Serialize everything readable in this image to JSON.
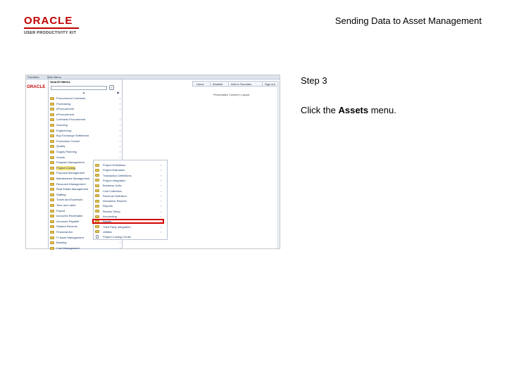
{
  "header": {
    "brand": "ORACLE",
    "product": "USER PRODUCTIVITY KIT",
    "doc_title": "Sending Data to Asset Management"
  },
  "screenshot": {
    "topbar": {
      "favorites": "Favorites",
      "main_menu": "Main Menu"
    },
    "mini_logo": "ORACLE",
    "nav": {
      "home": "Home",
      "worklist": "Worklist",
      "add_to_favorites": "Add to Favorites",
      "sign_out": "Sign out"
    },
    "personalize": "Personalize Content | Layout",
    "menu": {
      "title": "Search Menu:",
      "go": "»",
      "items": [
        {
          "label": "Procurement Contracts",
          "arrow": "›"
        },
        {
          "label": "Purchasing",
          "arrow": "›"
        },
        {
          "label": "eProcurement",
          "arrow": "›"
        },
        {
          "label": "eProcurement",
          "arrow": ""
        },
        {
          "label": "Contracts Procurement",
          "arrow": "›"
        },
        {
          "label": "Sourcing",
          "arrow": "›"
        },
        {
          "label": "Engineering",
          "arrow": "›"
        },
        {
          "label": "Buy Exchange Settlement",
          "arrow": "›"
        },
        {
          "label": "Production Control",
          "arrow": "›"
        },
        {
          "label": "Quality",
          "arrow": "›"
        },
        {
          "label": "Supply Planning",
          "arrow": "›"
        },
        {
          "label": "Grants",
          "arrow": "›"
        },
        {
          "label": "Program Management",
          "arrow": "›"
        },
        {
          "label": "Project Costing",
          "arrow": "›"
        },
        {
          "label": "Proposal Management",
          "arrow": "›"
        },
        {
          "label": "Maintenance Management",
          "arrow": "›"
        },
        {
          "label": "Resource Management",
          "arrow": "›"
        },
        {
          "label": "Real Estate Management",
          "arrow": "›"
        },
        {
          "label": "Staffing",
          "arrow": "›"
        },
        {
          "label": "Travel and Expenses",
          "arrow": "›"
        },
        {
          "label": "Time and Labor",
          "arrow": "›"
        },
        {
          "label": "Payroll",
          "arrow": "›"
        },
        {
          "label": "Accounts Receivable",
          "arrow": "›"
        },
        {
          "label": "Accounts Payable",
          "arrow": "›"
        },
        {
          "label": "Student Records",
          "arrow": "›"
        },
        {
          "label": "Financial Aid",
          "arrow": "›"
        },
        {
          "label": "IT Asset Management",
          "arrow": "›"
        },
        {
          "label": "Banking",
          "arrow": "›"
        },
        {
          "label": "Cost Management",
          "arrow": "›"
        }
      ]
    },
    "submenu": {
      "items": [
        {
          "label": "Project Definitions",
          "arrow": "›",
          "icon": "folder"
        },
        {
          "label": "Project Estimates",
          "arrow": "›",
          "icon": "folder"
        },
        {
          "label": "Transaction Definitions",
          "arrow": "›",
          "icon": "folder"
        },
        {
          "label": "Project Integration",
          "arrow": "›",
          "icon": "folder"
        },
        {
          "label": "Business Units",
          "arrow": "›",
          "icon": "folder"
        },
        {
          "label": "Cost Collection",
          "arrow": "›",
          "icon": "folder"
        },
        {
          "label": "Revenue Definition",
          "arrow": "›",
          "icon": "folder"
        },
        {
          "label": "Interactive Reports",
          "arrow": "›",
          "icon": "folder"
        },
        {
          "label": "Reports",
          "arrow": "›",
          "icon": "folder"
        },
        {
          "label": "Review Setup",
          "arrow": "›",
          "icon": "folder"
        },
        {
          "label": "Accounting",
          "arrow": "›",
          "icon": "folder"
        },
        {
          "label": "Assets",
          "arrow": "›",
          "icon": "folder"
        },
        {
          "label": "Third Party Integration",
          "arrow": "›",
          "icon": "folder"
        },
        {
          "label": "Utilities",
          "arrow": "›",
          "icon": "folder"
        },
        {
          "label": "Project Costing Center",
          "arrow": "",
          "icon": "document"
        }
      ]
    }
  },
  "instructions": {
    "step": "Step 3",
    "text_before": "Click the ",
    "text_bold": "Assets",
    "text_after": " menu."
  },
  "colors": {
    "brand_red": "#c00000",
    "highlight_red": "#d40000",
    "menu_highlight": "#f6e27d",
    "folder": "#e0c253"
  }
}
